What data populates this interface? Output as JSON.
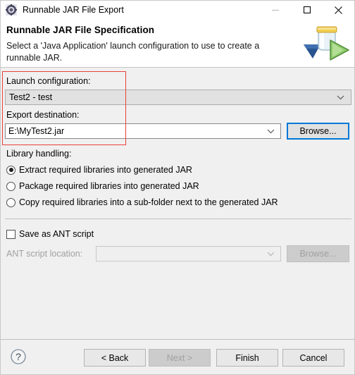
{
  "window": {
    "title": "Runnable JAR File Export",
    "app_icon": "wizard-gear-icon",
    "controls": {
      "minimize": "minimize-icon",
      "maximize": "maximize-icon",
      "close": "close-icon"
    }
  },
  "header": {
    "title": "Runnable JAR File Specification",
    "description": "Select a 'Java Application' launch configuration to use to create a runnable JAR.",
    "art": "jar-export-banner-icon"
  },
  "form": {
    "launch_configuration": {
      "label": "Launch configuration:",
      "value": "Test2 - test",
      "arrow": "chevron-down-icon"
    },
    "export_destination": {
      "label": "Export destination:",
      "value": "E:\\MyTest2.jar",
      "placeholder": "",
      "arrow": "chevron-down-icon",
      "browse_label": "Browse..."
    },
    "library_handling": {
      "label": "Library handling:",
      "options": [
        {
          "label": "Extract required libraries into generated JAR",
          "selected": true
        },
        {
          "label": "Package required libraries into generated JAR",
          "selected": false
        },
        {
          "label": "Copy required libraries into a sub-folder next to the generated JAR",
          "selected": false
        }
      ]
    },
    "ant_script": {
      "checkbox_label": "Save as ANT script",
      "checked": false,
      "location_label": "ANT script location:",
      "location_value": "",
      "location_placeholder": "",
      "arrow": "chevron-down-icon",
      "browse_label": "Browse..."
    }
  },
  "footer": {
    "help": "help-icon",
    "buttons": [
      {
        "label": "< Back",
        "enabled": true
      },
      {
        "label": "Next >",
        "enabled": false
      },
      {
        "label": "Finish",
        "enabled": true
      },
      {
        "label": "Cancel",
        "enabled": true
      }
    ]
  },
  "annotation": {
    "color": "#e8403a"
  }
}
